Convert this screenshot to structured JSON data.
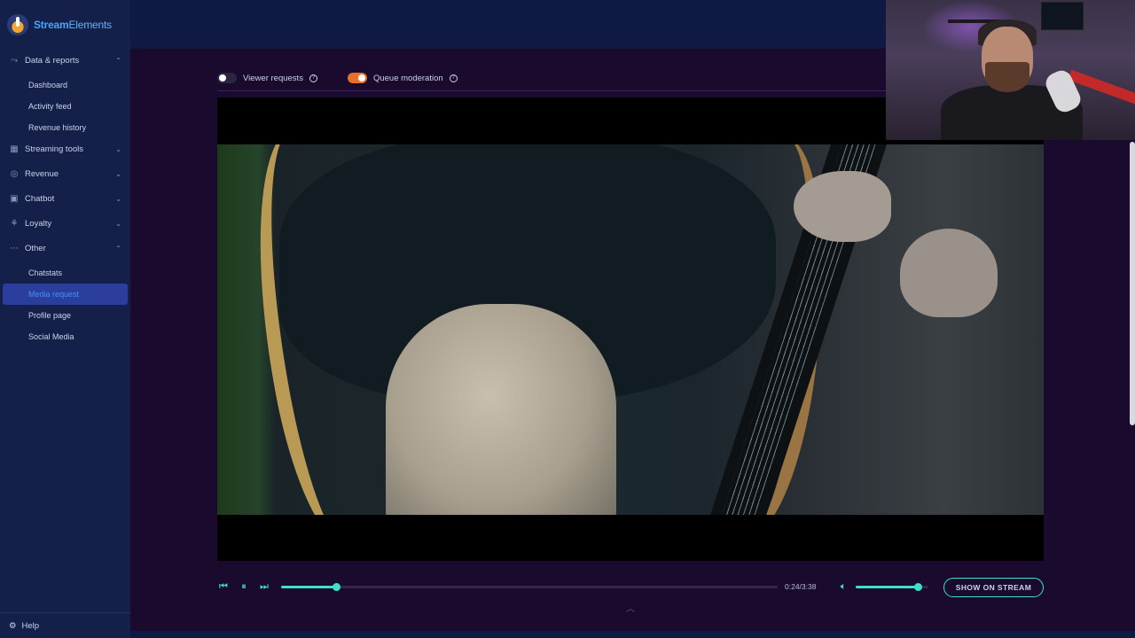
{
  "brand": {
    "name_a": "Stream",
    "name_b": "Elements"
  },
  "sidebar": {
    "groups": [
      {
        "label": "Data & reports",
        "icon": "chart-line-icon",
        "expanded": true
      },
      {
        "label": "Streaming tools",
        "icon": "layout-icon",
        "expanded": false
      },
      {
        "label": "Revenue",
        "icon": "coin-icon",
        "expanded": false
      },
      {
        "label": "Chatbot",
        "icon": "robot-icon",
        "expanded": false
      },
      {
        "label": "Loyalty",
        "icon": "medal-icon",
        "expanded": false
      },
      {
        "label": "Other",
        "icon": "dots-icon",
        "expanded": true
      }
    ],
    "data_items": [
      "Dashboard",
      "Activity feed",
      "Revenue history"
    ],
    "other_items": [
      "Chatstats",
      "Media request",
      "Profile page",
      "Social Media"
    ],
    "active_item": "Media request",
    "help": "Help"
  },
  "toggles": {
    "viewer_requests": {
      "label": "Viewer requests",
      "on": false
    },
    "queue_moderation": {
      "label": "Queue moderation",
      "on": true
    }
  },
  "player": {
    "time": "0:24/3:38",
    "progress_fraction": 0.11,
    "volume_fraction": 0.85,
    "show_on_stream": "SHOW ON STREAM"
  },
  "colors": {
    "accent": "#3fe0c8",
    "active_nav": "#2c3e9b",
    "toggle_on": "#e8702a"
  }
}
